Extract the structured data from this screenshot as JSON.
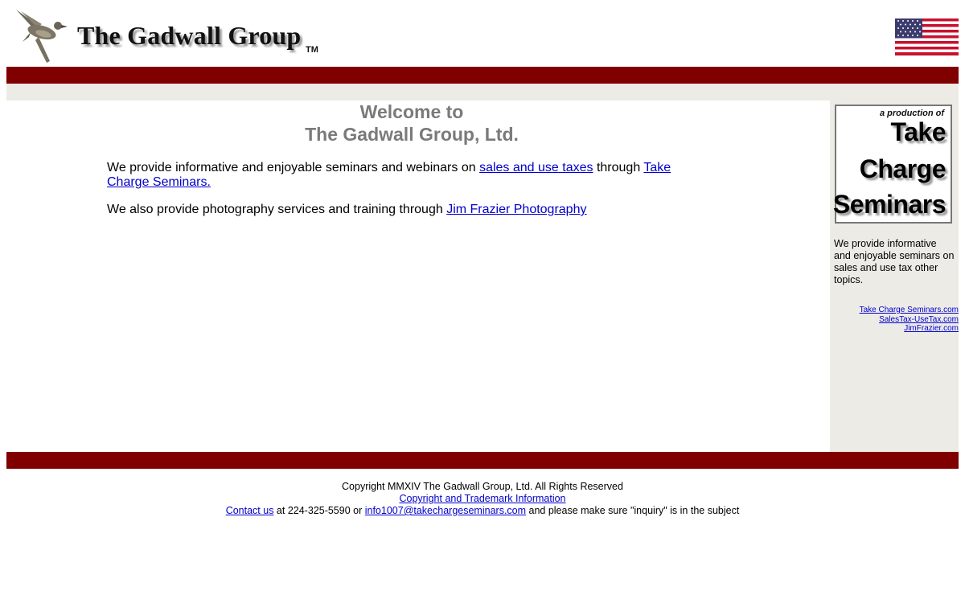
{
  "header": {
    "logo_text": "The Gadwall Group",
    "tm": "TM"
  },
  "main": {
    "welcome_line1": "Welcome to",
    "welcome_line2": "The Gadwall Group, Ltd.",
    "p1_before": "We provide informative and enjoyable seminars and webinars on ",
    "p1_link1": "sales and use taxes",
    "p1_middle": " through ",
    "p1_link2": "Take Charge Seminars.",
    "p2_before": "We also provide photography services and training through ",
    "p2_link": "Jim Frazier Photography"
  },
  "sidebar": {
    "promo_small": "a production of",
    "promo_line1": "Take",
    "promo_line2": "Charge",
    "promo_line3": "Seminars",
    "description": "We provide informative and enjoyable seminars on sales and use tax other topics.",
    "links": [
      "Take Charge Seminars.com",
      "SalesTax-UseTax.com",
      "JimFrazier.com"
    ]
  },
  "footer": {
    "copyright": "Copyright MMXIV The Gadwall Group, Ltd.  All Rights Reserved",
    "trademark_link": "Copyright and Trademark Information",
    "contact_link": "Contact us",
    "contact_middle": " at 224-325-5590 or ",
    "email_link": "info1007@takechargeseminars.com",
    "contact_end": " and please make sure \"inquiry\" is in the subject"
  },
  "colors": {
    "bar": "#800000",
    "sidebar_bg": "#edebe6",
    "heading": "#7a7a7a",
    "link": "#0000cc"
  }
}
